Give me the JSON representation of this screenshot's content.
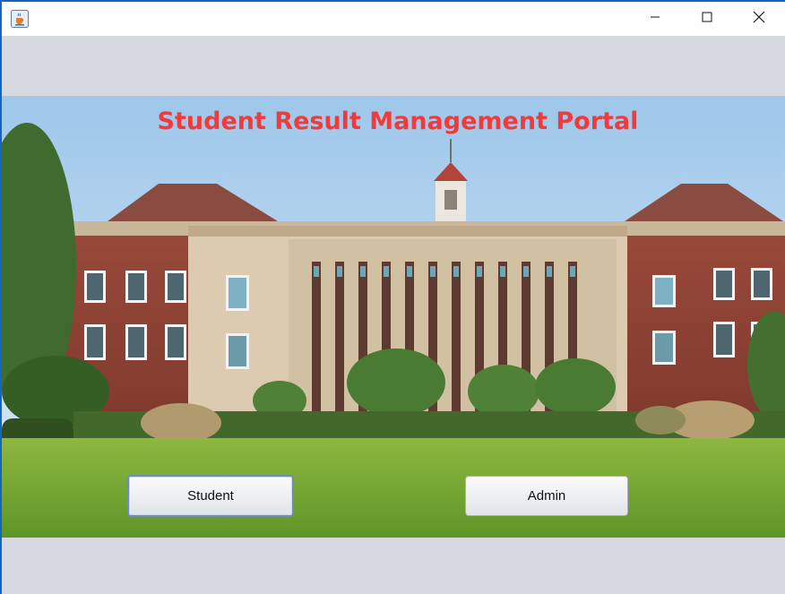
{
  "window": {
    "app_icon": "java-cup-icon",
    "controls": [
      "minimize-icon",
      "maximize-icon",
      "close-icon"
    ]
  },
  "portal": {
    "title": "Student Result Management Portal",
    "title_color": "#f23a3a"
  },
  "background": {
    "image": "university-building-photo"
  },
  "buttons": {
    "student": "Student",
    "admin": "Admin"
  }
}
